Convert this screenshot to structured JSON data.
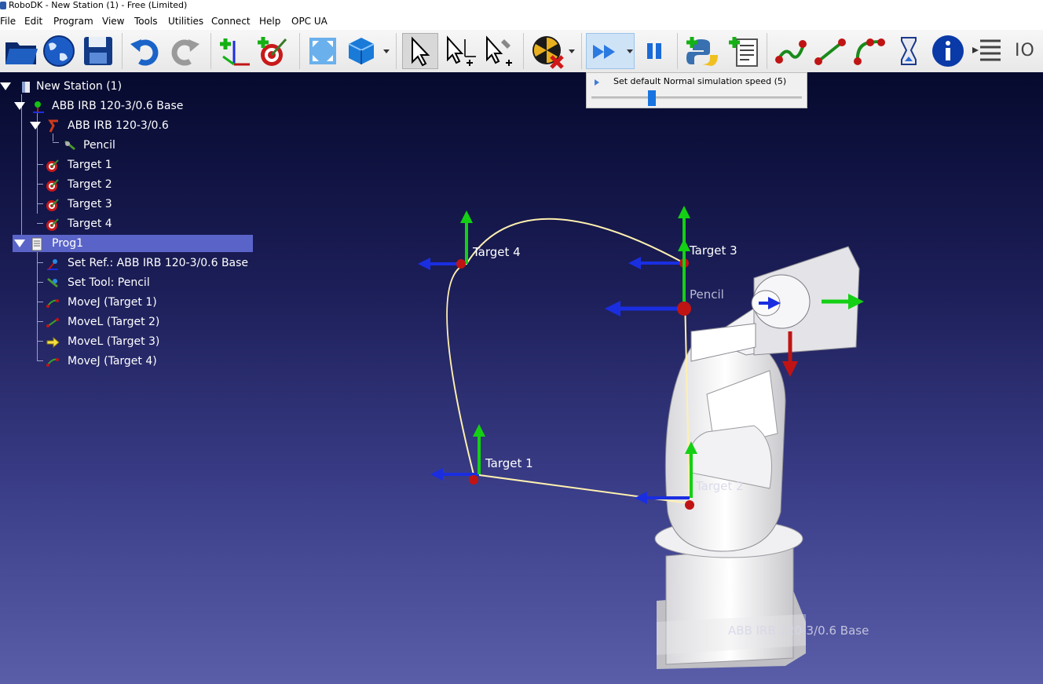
{
  "window": {
    "title": "RoboDK - New Station (1) - Free (Limited)"
  },
  "menu": [
    "File",
    "Edit",
    "Program",
    "View",
    "Tools",
    "Utilities",
    "Connect",
    "Help",
    "OPC UA"
  ],
  "toolbar": {
    "buttons": [
      "open-icon",
      "web-library-icon",
      "save-icon",
      "undo-icon",
      "redo-icon",
      "add-reference-frame-icon",
      "add-target-icon",
      "fit-all-icon",
      "view-3d-icon",
      "select-icon",
      "move-reference-icon",
      "move-tool-icon",
      "collision-icon",
      "fast-simulation-icon",
      "pause-icon",
      "add-python-program-icon",
      "add-program-icon",
      "joint-move-icon",
      "linear-move-icon",
      "circular-move-icon",
      "pause-instruction-icon",
      "info-icon",
      "program-call-icon",
      "io-icon"
    ],
    "io_label": "IO"
  },
  "speed_popup": {
    "label": "Set default Normal simulation speed (5)",
    "slider_level": 0.27
  },
  "tree": {
    "station": "New Station (1)",
    "robot_base": "ABB IRB 120-3/0.6 Base",
    "robot": "ABB IRB 120-3/0.6",
    "tool": "Pencil",
    "targets": [
      "Target 1",
      "Target 2",
      "Target 3",
      "Target 4"
    ],
    "program": "Prog1",
    "instructions": [
      "Set Ref.: ABB IRB 120-3/0.6 Base",
      "Set Tool: Pencil",
      "MoveJ (Target 1)",
      "MoveL (Target 2)",
      "MoveL (Target 3)",
      "MoveJ (Target 4)"
    ]
  },
  "scene": {
    "target_labels": [
      "Target 4",
      "Target 3",
      "Target 1",
      "Target 2"
    ],
    "tool_label": "Pencil",
    "base_label": "ABB IRB 120-3/0.6 Base"
  },
  "colors": {
    "axis_x": "#1a2ee0",
    "axis_y": "#14d014",
    "axis_z": "#c01414",
    "path": "#fff0b0",
    "background_top": "#060a2e",
    "background_bottom": "#5a5ea8"
  }
}
